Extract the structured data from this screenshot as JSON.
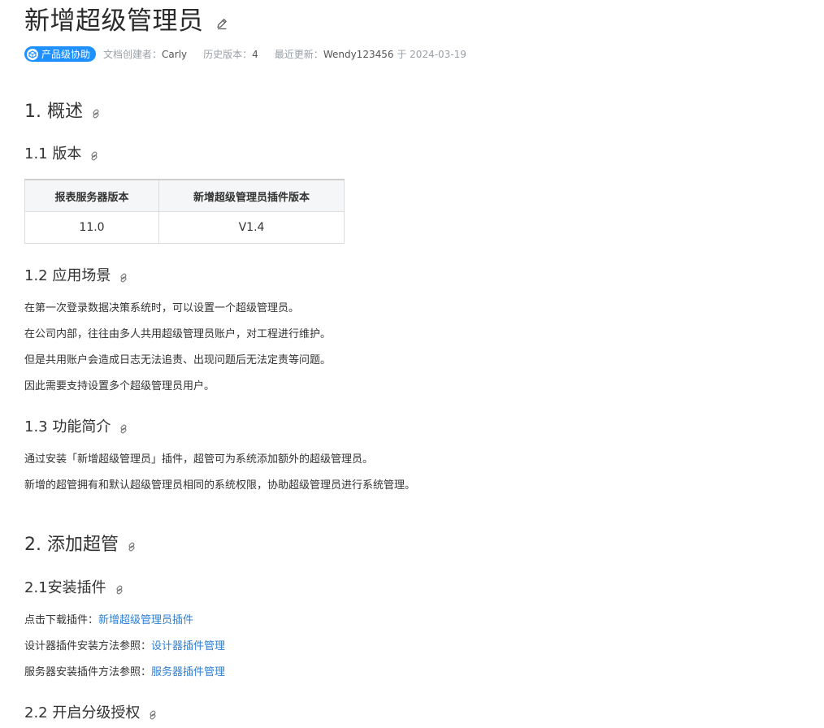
{
  "doc": {
    "title": "新增超级管理员",
    "badge": "产品级协助",
    "creator_label": "文档创建者：",
    "creator": "Carly",
    "version_label": "历史版本：",
    "version": "4",
    "updated_label": "最近更新：",
    "updated_by": "Wendy123456",
    "updated_prefix": "于",
    "updated_date": "2024-03-19"
  },
  "sections": {
    "s1": {
      "heading": "1. 概述"
    },
    "s1_1": {
      "heading": "1.1 版本",
      "table": {
        "headers": [
          "报表服务器版本",
          "新增超级管理员插件版本"
        ],
        "rows": [
          [
            "11.0",
            "V1.4"
          ]
        ]
      }
    },
    "s1_2": {
      "heading": "1.2 应用场景",
      "paras": [
        "在第一次登录数据决策系统时，可以设置一个超级管理员。",
        "在公司内部，往往由多人共用超级管理员账户，对工程进行维护。",
        "但是共用账户会造成日志无法追责、出现问题后无法定责等问题。",
        "因此需要支持设置多个超级管理员用户。"
      ]
    },
    "s1_3": {
      "heading": "1.3 功能简介",
      "paras": [
        "通过安装「新增超级管理员」插件，超管可为系统添加额外的超级管理员。",
        "新增的超管拥有和默认超级管理员相同的系统权限，协助超级管理员进行系统管理。"
      ]
    },
    "s2": {
      "heading": "2. 添加超管"
    },
    "s2_1": {
      "heading": "2.1安装插件",
      "lines": [
        {
          "text": "点击下载插件：",
          "link": "新增超级管理员插件"
        },
        {
          "text": "设计器插件安装方法参照：",
          "link": "设计器插件管理"
        },
        {
          "text": "服务器安装插件方法参照：",
          "link": "服务器插件管理"
        }
      ]
    },
    "s2_2": {
      "heading": "2.2 开启分级授权"
    }
  },
  "colors": {
    "accent": "#1e90ff",
    "link": "#2f7fd4",
    "meta": "#9aa0a6"
  },
  "icons": {
    "edit": "pencil-icon",
    "anchor": "link-icon",
    "badge": "cube-icon"
  }
}
